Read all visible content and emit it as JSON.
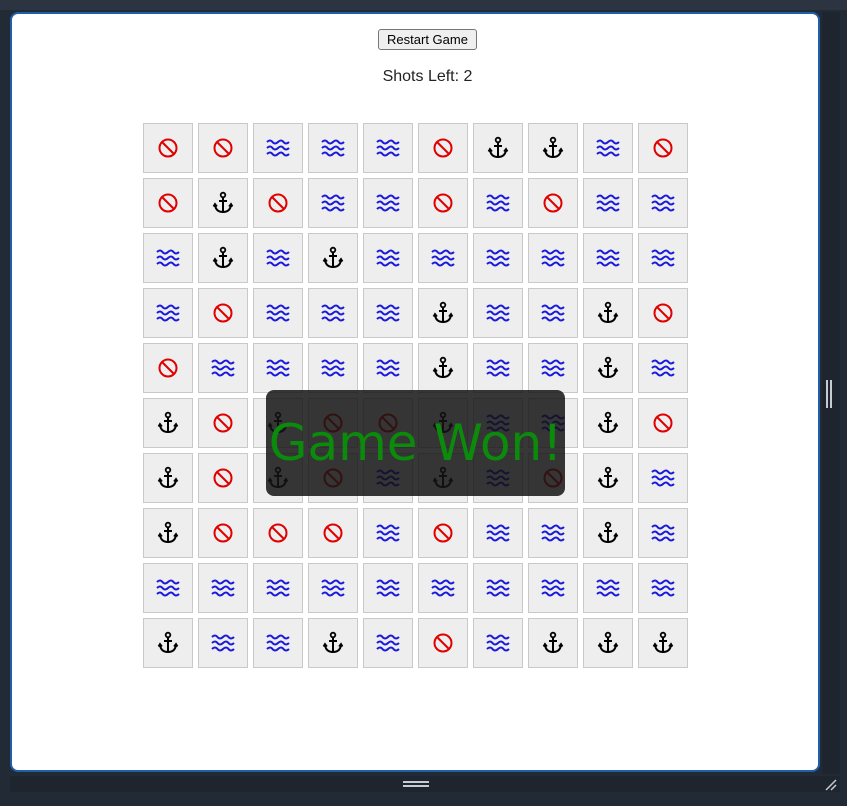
{
  "controls": {
    "restart_label": "Restart Game",
    "shots_label": "Shots Left: 2"
  },
  "overlay": {
    "message": "Game Won!",
    "color": "#0b8a0b"
  },
  "legend_colors": {
    "miss": "#e00000",
    "water": "#1a1adb",
    "ship": "#000000"
  },
  "board": {
    "rows": 10,
    "cols": 10,
    "cells": [
      [
        "miss",
        "miss",
        "water",
        "water",
        "water",
        "miss",
        "ship",
        "ship",
        "water",
        "miss"
      ],
      [
        "miss",
        "ship",
        "miss",
        "water",
        "water",
        "miss",
        "water",
        "miss",
        "water",
        "water"
      ],
      [
        "water",
        "ship",
        "water",
        "ship",
        "water",
        "water",
        "water",
        "water",
        "water",
        "water"
      ],
      [
        "water",
        "miss",
        "water",
        "water",
        "water",
        "ship",
        "water",
        "water",
        "ship",
        "miss"
      ],
      [
        "miss",
        "water",
        "water",
        "water",
        "water",
        "ship",
        "water",
        "water",
        "ship",
        "water"
      ],
      [
        "ship",
        "miss",
        "ship",
        "miss",
        "miss",
        "ship",
        "water",
        "water",
        "ship",
        "miss"
      ],
      [
        "ship",
        "miss",
        "ship",
        "miss",
        "water",
        "ship",
        "water",
        "miss",
        "ship",
        "water"
      ],
      [
        "ship",
        "miss",
        "miss",
        "miss",
        "water",
        "miss",
        "water",
        "water",
        "ship",
        "water"
      ],
      [
        "water",
        "water",
        "water",
        "water",
        "water",
        "water",
        "water",
        "water",
        "water",
        "water"
      ],
      [
        "ship",
        "water",
        "water",
        "ship",
        "water",
        "miss",
        "water",
        "ship",
        "ship",
        "ship"
      ]
    ]
  }
}
